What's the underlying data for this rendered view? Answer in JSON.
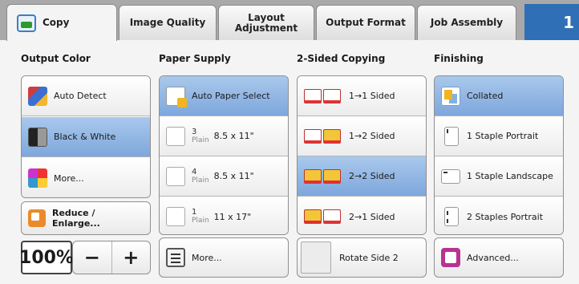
{
  "tabs": [
    {
      "label": "Copy",
      "active": true
    },
    {
      "label": "Image Quality"
    },
    {
      "label": "Layout Adjustment"
    },
    {
      "label": "Output Format"
    },
    {
      "label": "Job Assembly"
    }
  ],
  "tab_number": "1",
  "columns": {
    "output_color": {
      "header": "Output Color",
      "options": [
        {
          "label": "Auto Detect",
          "icon": "auto-detect-icon"
        },
        {
          "label": "Black & White",
          "icon": "black-white-icon",
          "selected": true
        },
        {
          "label": "More...",
          "icon": "color-more-icon"
        }
      ]
    },
    "paper_supply": {
      "header": "Paper Supply",
      "options": [
        {
          "label": "Auto Paper Select",
          "icon": "auto-paper-icon",
          "selected": true
        },
        {
          "tray": "3",
          "type": "Plain",
          "size": "8.5 x 11\""
        },
        {
          "tray": "4",
          "type": "Plain",
          "size": "8.5 x 11\""
        },
        {
          "tray": "1",
          "type": "Plain",
          "size": "11 x 17\""
        }
      ],
      "more_label": "More..."
    },
    "two_sided": {
      "header": "2-Sided Copying",
      "options": [
        {
          "label": "1→1 Sided"
        },
        {
          "label": "1→2 Sided"
        },
        {
          "label": "2→2 Sided",
          "selected": true
        },
        {
          "label": "2→1 Sided"
        }
      ],
      "rotate_label": "Rotate Side 2"
    },
    "finishing": {
      "header": "Finishing",
      "options": [
        {
          "label": "Collated",
          "selected": true
        },
        {
          "label": "1 Staple Portrait"
        },
        {
          "label": "1 Staple Landscape"
        },
        {
          "label": "2 Staples Portrait"
        }
      ],
      "advanced_label": "Advanced..."
    }
  },
  "reduce_enlarge": {
    "line1": "Reduce /",
    "line2": "Enlarge..."
  },
  "zoom": {
    "value": "100%",
    "minus": "−",
    "plus": "+"
  },
  "colors": {
    "accent": "#2e6fb6",
    "selected": "#8fb4e2"
  }
}
